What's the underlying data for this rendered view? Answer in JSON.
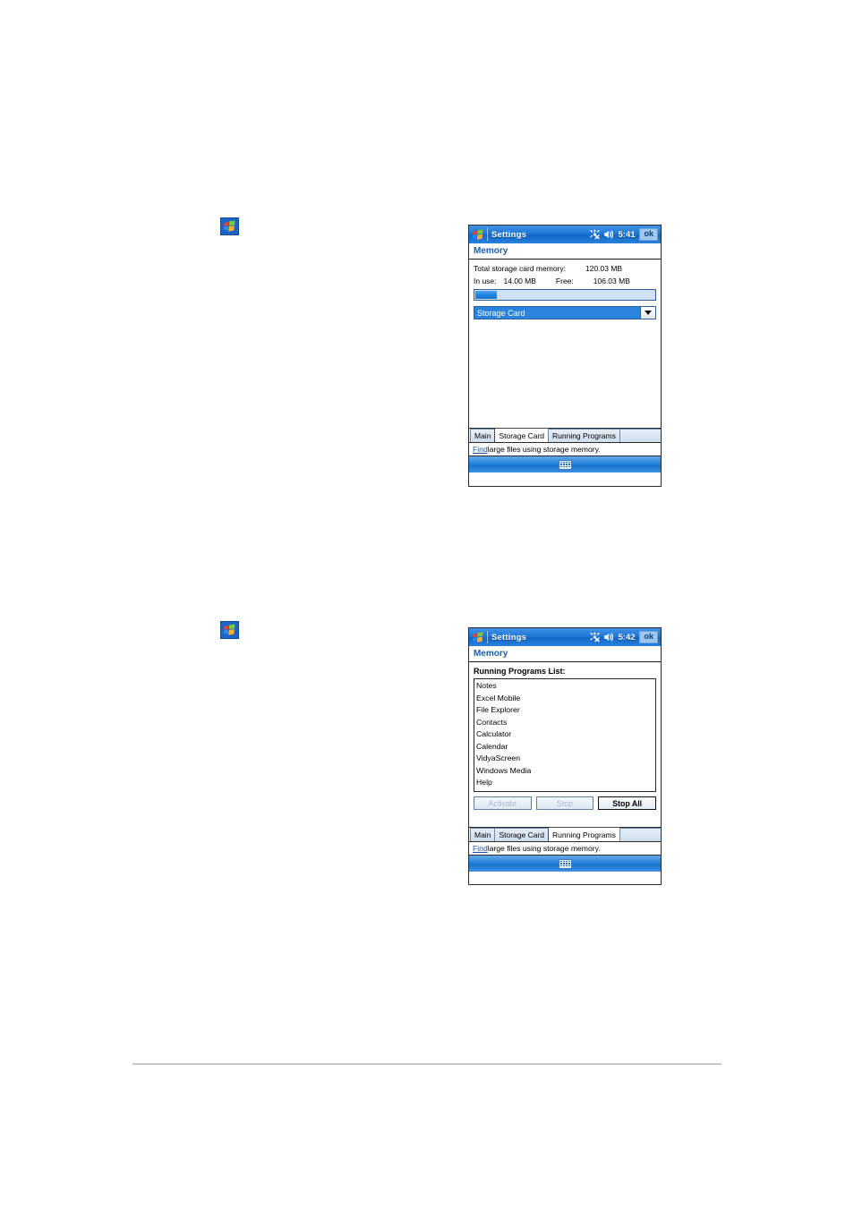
{
  "page": {
    "background_color": "#ffffff",
    "rule_color": "#c8c8c8"
  },
  "badges": [
    {
      "name": "windows-logo-badge-1",
      "icon": "windows-flag-icon"
    },
    {
      "name": "windows-logo-badge-2",
      "icon": "windows-flag-icon"
    }
  ],
  "screenshot_storage_card": {
    "titlebar": {
      "logo_icon": "windows-flag-icon",
      "title": "Settings",
      "connectivity_icon": "connectivity-disconnected-icon",
      "volume_icon": "speaker-volume-icon",
      "time": "5:41",
      "ok_label": "ok"
    },
    "subheader": "Memory",
    "total_label": "Total storage card memory:",
    "total_value": "120.03 MB",
    "inuse_label": "In use:",
    "inuse_value": "14.00 MB",
    "free_label": "Free:",
    "free_value": "106.03 MB",
    "progress": {
      "percent": 11.7,
      "fill_color": "#2183dd",
      "track_color": "#cfe0f3"
    },
    "combo": {
      "selected": "Storage Card",
      "arrow_icon": "chevron-down-icon",
      "highlight_color": "#2a84dd"
    },
    "tabs": [
      {
        "label": "Main",
        "active": false
      },
      {
        "label": "Storage Card",
        "active": true
      },
      {
        "label": "Running Programs",
        "active": false
      }
    ],
    "findbar": {
      "link": "Find",
      "text": " large files using storage memory."
    },
    "sip_icon": "keyboard-icon"
  },
  "screenshot_running_programs": {
    "titlebar": {
      "logo_icon": "windows-flag-icon",
      "title": "Settings",
      "connectivity_icon": "connectivity-disconnected-icon",
      "volume_icon": "speaker-volume-icon",
      "time": "5:42",
      "ok_label": "ok"
    },
    "subheader": "Memory",
    "list_title": "Running Programs List:",
    "programs": [
      "Notes",
      "Excel Mobile",
      "File Explorer",
      "Contacts",
      "Calculator",
      "Calendar",
      "VidyaScreen",
      "Windows Media",
      "Help"
    ],
    "buttons": [
      {
        "label": "Activate",
        "enabled": false
      },
      {
        "label": "Stop",
        "enabled": false
      },
      {
        "label": "Stop All",
        "enabled": true
      }
    ],
    "tabs": [
      {
        "label": "Main",
        "active": false
      },
      {
        "label": "Storage Card",
        "active": false
      },
      {
        "label": "Running Programs",
        "active": true
      }
    ],
    "findbar": {
      "link": "Find",
      "text": " large files using storage memory."
    },
    "sip_icon": "keyboard-icon"
  }
}
